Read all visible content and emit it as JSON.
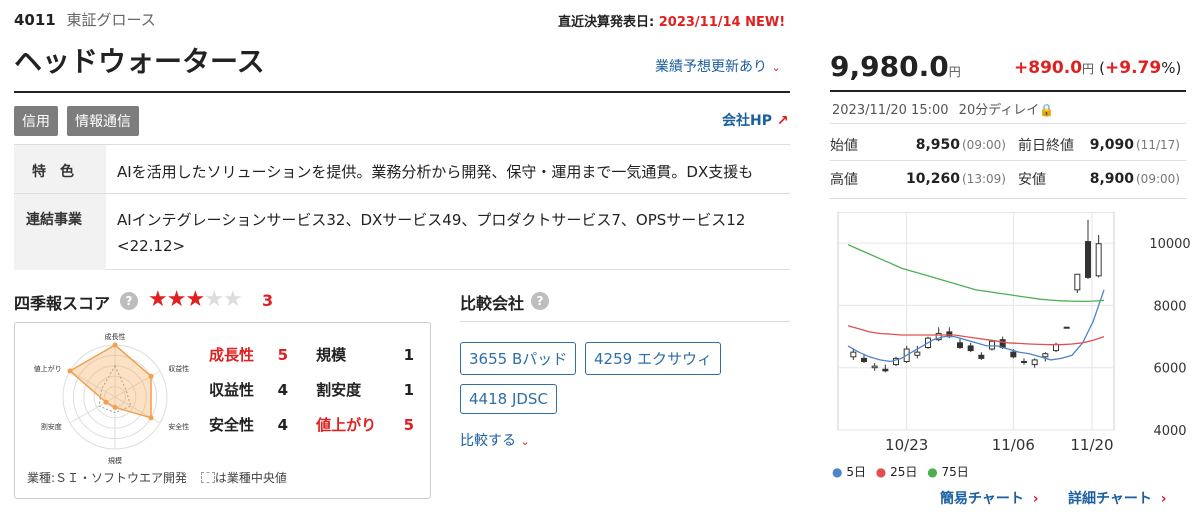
{
  "header": {
    "code": "4011",
    "market": "東証グロース",
    "earnings_label": "直近決算発表日:",
    "earnings_date": "2023/11/14",
    "earnings_new": "NEW!",
    "company_name": "ヘッドウォータース",
    "forecast_link": "業績予想更新あり",
    "tags": [
      "信用",
      "情報通信"
    ],
    "company_hp": "会社HP"
  },
  "profile": {
    "feature_label": "特　色",
    "feature_text": "AIを活用したソリューションを提供。業務分析から開発、保守・運用まで一気通貫。DX支援も",
    "segments_label": "連結事業",
    "segments_text_line1": "AIインテグレーションサービス32、DXサービス49、プロダクトサービス7、OPSサービス12",
    "segments_text_line2": "<22.12>"
  },
  "score": {
    "title": "四季報スコア",
    "rating": 3,
    "rating_max": 5,
    "rating_text": "3",
    "items": [
      {
        "label": "成長性",
        "value": "5",
        "highlight": true
      },
      {
        "label": "規模",
        "value": "1",
        "highlight": false
      },
      {
        "label": "収益性",
        "value": "4",
        "highlight": false
      },
      {
        "label": "割安度",
        "value": "1",
        "highlight": false
      },
      {
        "label": "安全性",
        "value": "4",
        "highlight": false
      },
      {
        "label": "値上がり",
        "value": "5",
        "highlight": true
      }
    ],
    "radar_labels": [
      "成長性",
      "収益性",
      "安全性",
      "規模",
      "割安度",
      "値上がり"
    ],
    "radar_values": [
      5,
      4,
      4,
      1,
      1,
      5
    ],
    "industry_label": "業種:ＳＩ・ソフトウエア開発",
    "median_label": "は業種中央値"
  },
  "compare": {
    "title": "比較会社",
    "companies": [
      "3655 Bパッド",
      "4259 エクサウィ",
      "4418 JDSC"
    ],
    "more_link": "比較する"
  },
  "price": {
    "price": "9,980.0",
    "unit": "円",
    "change": "+890.0",
    "change_unit": "円",
    "change_pct_open": "(",
    "change_pct": "+9.79",
    "change_pct_close": "%)",
    "datetime": "2023/11/20 15:00",
    "delay": "20分ディレイ",
    "open_label": "始値",
    "open_value": "8,950",
    "open_time": "(09:00)",
    "prev_label": "前日終値",
    "prev_value": "9,090",
    "prev_time": "(11/17)",
    "high_label": "高値",
    "high_value": "10,260",
    "high_time": "(13:09)",
    "low_label": "安値",
    "low_value": "8,900",
    "low_time": "(09:00)"
  },
  "chart_legend": {
    "ma5": "5日",
    "ma25": "25日",
    "ma75": "75日"
  },
  "chart_links": {
    "simple": "簡易チャート",
    "detail": "詳細チャート"
  },
  "colors": {
    "red": "#e02020",
    "link": "#1a5fa0",
    "star": "#e02020",
    "ma5": "#4a86c8",
    "ma25": "#e05050",
    "ma75": "#4caf50"
  },
  "chart_data": {
    "type": "line",
    "x_ticks": [
      "10/23",
      "11/06",
      "11/20"
    ],
    "y_ticks": [
      "10000",
      "8000",
      "6000",
      "4000"
    ],
    "ylim": [
      4000,
      11000
    ],
    "grid": true,
    "series": [
      {
        "name": "5日",
        "values": [
          6700,
          6500,
          6350,
          6250,
          6200,
          6300,
          6500,
          6700,
          6900,
          7000,
          7000,
          6900,
          6800,
          6700,
          6700,
          6600,
          6500,
          6450,
          6350,
          6250,
          6300,
          6400,
          6800,
          7500,
          8500
        ]
      },
      {
        "name": "25日",
        "values": [
          7350,
          7250,
          7150,
          7100,
          7080,
          7050,
          7050,
          7050,
          7050,
          7050,
          7050,
          7000,
          6950,
          6900,
          6850,
          6800,
          6780,
          6760,
          6750,
          6740,
          6740,
          6760,
          6800,
          6880,
          7000
        ]
      },
      {
        "name": "75日",
        "values": [
          9950,
          9800,
          9650,
          9500,
          9350,
          9200,
          9100,
          9000,
          8900,
          8800,
          8700,
          8600,
          8500,
          8450,
          8400,
          8350,
          8300,
          8250,
          8200,
          8170,
          8150,
          8140,
          8130,
          8140,
          8160
        ]
      }
    ],
    "candles": [
      {
        "o": 6350,
        "h": 6600,
        "l": 6250,
        "c": 6500
      },
      {
        "o": 6300,
        "h": 6450,
        "l": 6150,
        "c": 6200
      },
      {
        "o": 6000,
        "h": 6150,
        "l": 5900,
        "c": 6050
      },
      {
        "o": 5950,
        "h": 6100,
        "l": 5850,
        "c": 5900
      },
      {
        "o": 6100,
        "h": 6350,
        "l": 6050,
        "c": 6300
      },
      {
        "o": 6200,
        "h": 6700,
        "l": 6150,
        "c": 6600
      },
      {
        "o": 6400,
        "h": 6700,
        "l": 6300,
        "c": 6500
      },
      {
        "o": 6650,
        "h": 7000,
        "l": 6600,
        "c": 6950
      },
      {
        "o": 6900,
        "h": 7300,
        "l": 6850,
        "c": 7100
      },
      {
        "o": 7150,
        "h": 7300,
        "l": 6950,
        "c": 7000
      },
      {
        "o": 6800,
        "h": 6950,
        "l": 6600,
        "c": 6650
      },
      {
        "o": 6700,
        "h": 6800,
        "l": 6500,
        "c": 6550
      },
      {
        "o": 6400,
        "h": 6500,
        "l": 6250,
        "c": 6300
      },
      {
        "o": 6600,
        "h": 6900,
        "l": 6550,
        "c": 6850
      },
      {
        "o": 6900,
        "h": 7000,
        "l": 6600,
        "c": 6650
      },
      {
        "o": 6500,
        "h": 6600,
        "l": 6300,
        "c": 6350
      },
      {
        "o": 6200,
        "h": 6300,
        "l": 6100,
        "c": 6200
      },
      {
        "o": 6100,
        "h": 6300,
        "l": 6000,
        "c": 6250
      },
      {
        "o": 6350,
        "h": 6500,
        "l": 6200,
        "c": 6450
      },
      {
        "o": 6550,
        "h": 6800,
        "l": 6500,
        "c": 6750
      },
      {
        "o": 7300,
        "h": 7300,
        "l": 7300,
        "c": 7300
      },
      {
        "o": 8500,
        "h": 9000,
        "l": 8400,
        "c": 9000
      },
      {
        "o": 10050,
        "h": 10750,
        "l": 8850,
        "c": 8900
      },
      {
        "o": 8950,
        "h": 10260,
        "l": 8900,
        "c": 9980
      }
    ]
  }
}
